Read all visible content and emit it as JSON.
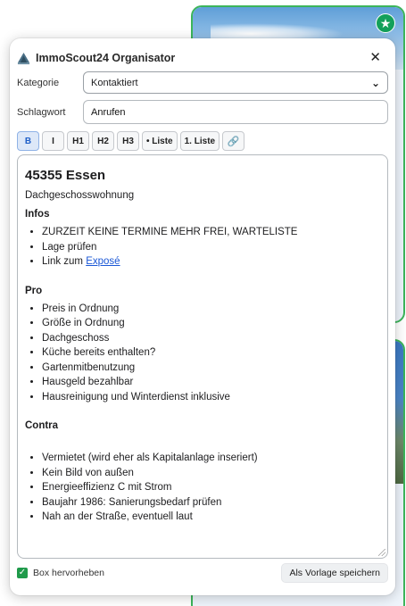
{
  "app": {
    "title": "ImmoScout24 Organisator",
    "logo_icon": "house-logo-icon",
    "close_icon": "close-icon"
  },
  "badge": {
    "icon": "star-icon",
    "color": "#13a05a"
  },
  "form": {
    "category_label": "Kategorie",
    "category_value": "Kontaktiert",
    "keyword_label": "Schlagwort",
    "keyword_value": "Anrufen"
  },
  "toolbar": {
    "bold": "B",
    "italic": "I",
    "h1": "H1",
    "h2": "H2",
    "h3": "H3",
    "bullet_list": "• Liste",
    "numbered_list": "1. Liste",
    "link_icon": "link-icon"
  },
  "note": {
    "heading": "45355 Essen",
    "subtitle": "Dachgeschosswohnung",
    "infos_title": "Infos",
    "infos": [
      "ZURZEIT KEINE TERMINE MEHR FREI, WARTELISTE",
      "Lage prüfen"
    ],
    "link_prefix": "Link zum ",
    "link_text": "Exposé",
    "pro_title": "Pro",
    "pro": [
      "Preis in Ordnung",
      "Größe in Ordnung",
      "Dachgeschoss",
      "Küche bereits enthalten?",
      "Gartenmitbenutzung",
      "Hausgeld bezahlbar",
      "Hausreinigung und Winterdienst inklusive"
    ],
    "contra_title": "Contra",
    "contra": [
      "Vermietet (wird eher als Kapitalanlage inseriert)",
      "Kein Bild von außen",
      "Energieeffizienz C mit Strom",
      "Baujahr 1986: Sanierungsbedarf prüfen",
      "Nah an der Straße, eventuell laut"
    ]
  },
  "footer": {
    "highlight_label": "Box hervorheben",
    "highlight_checked": true,
    "save_template_label": "Als Vorlage speichern"
  },
  "colors": {
    "accent_green": "#3cb55a",
    "link_blue": "#1a57d6",
    "active_tool": "#dde8f8"
  }
}
